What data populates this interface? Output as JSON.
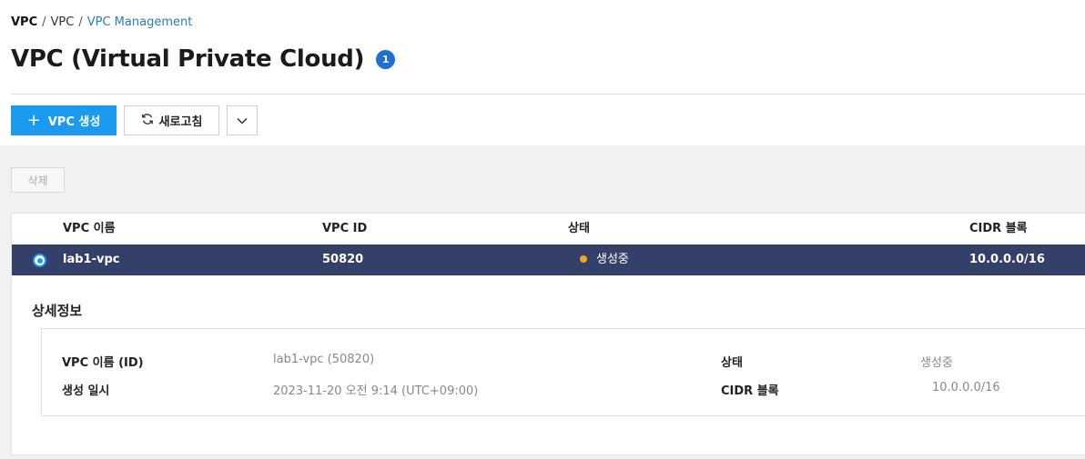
{
  "breadcrumb": {
    "root": "VPC",
    "middle": "VPC",
    "current": "VPC Management",
    "sep": "/"
  },
  "page": {
    "title": "VPC (Virtual Private Cloud)",
    "count": "1"
  },
  "toolbar": {
    "create_label": "VPC 생성",
    "refresh_label": "새로고침",
    "plus_icon": "plus-icon",
    "refresh_icon": "refresh-icon",
    "dropdown_icon": "chevron-down-icon"
  },
  "actions": {
    "delete_label": "삭제"
  },
  "table": {
    "columns": [
      "VPC 이름",
      "VPC ID",
      "상태",
      "CIDR 블록"
    ],
    "rows": [
      {
        "name": "lab1-vpc",
        "id": "50820",
        "status": "생성중",
        "cidr": "10.0.0.0/16",
        "selected": true
      }
    ]
  },
  "detail": {
    "title": "상세정보",
    "name_label": "VPC 이름 (ID)",
    "name_value": "lab1-vpc (50820)",
    "created_label": "생성 일시",
    "created_value": "2023-11-20 오전 9:14 (UTC+09:00)",
    "status_label": "상태",
    "status_value": "생성중",
    "cidr_label": "CIDR 블록",
    "cidr_value": "10.0.0.0/16"
  },
  "colors": {
    "primary": "#1a9bf0",
    "selected_row": "#344069",
    "status_pending": "#f0a81a",
    "badge": "#1e70d4"
  }
}
